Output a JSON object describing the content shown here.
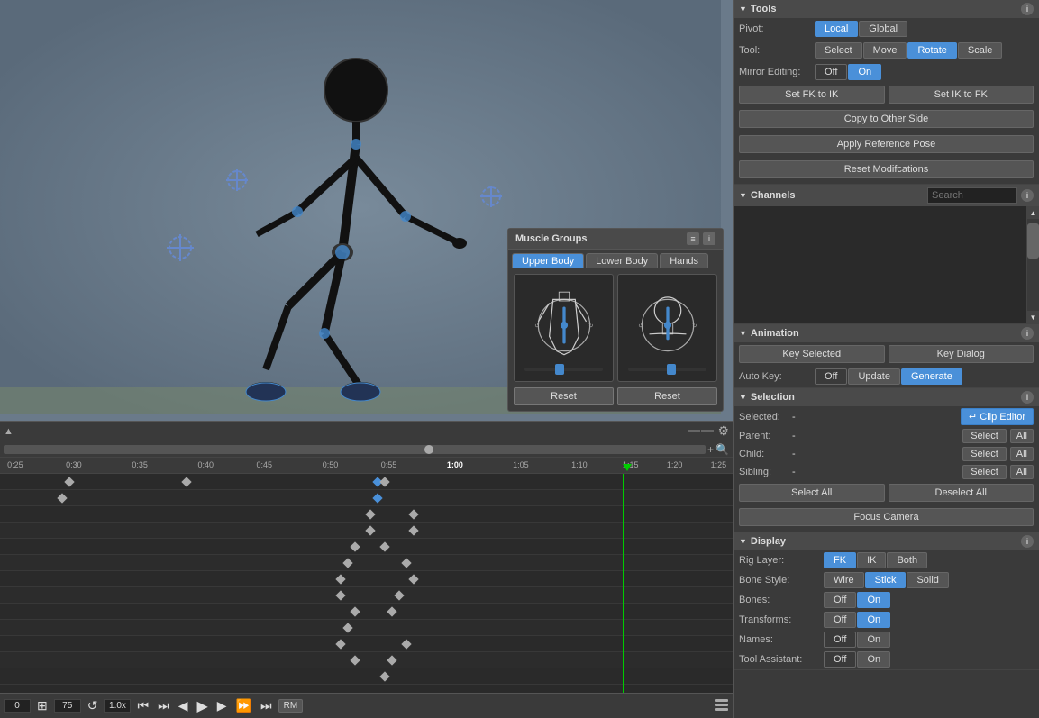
{
  "tools": {
    "title": "Tools",
    "pivot_label": "Pivot:",
    "tool_label": "Tool:",
    "mirror_label": "Mirror Editing:",
    "pivot_buttons": [
      "Local",
      "Global"
    ],
    "tool_buttons": [
      "Select",
      "Move",
      "Rotate",
      "Scale"
    ],
    "mirror_buttons": [
      "Off",
      "On"
    ],
    "active_pivot": "Local",
    "active_tool": "Rotate",
    "active_mirror": "Off",
    "set_fk_ik": "Set FK to IK",
    "set_ik_fk": "Set IK to FK",
    "copy_other_side": "Copy to Other Side",
    "apply_reference_pose": "Apply Reference Pose",
    "reset_modifications": "Reset Modifcations"
  },
  "channels": {
    "title": "Channels",
    "search_placeholder": "Search"
  },
  "animation": {
    "title": "Animation",
    "key_selected": "Key Selected",
    "key_dialog": "Key Dialog",
    "auto_key_label": "Auto Key:",
    "auto_key_buttons": [
      "Off",
      "Update",
      "Generate"
    ],
    "active_auto_key": "Off"
  },
  "selection": {
    "title": "Selection",
    "clip_editor_btn": "↵ Clip Editor",
    "selected_label": "Selected:",
    "selected_value": "-",
    "parent_label": "Parent:",
    "parent_value": "-",
    "child_label": "Child:",
    "child_value": "-",
    "sibling_label": "Sibling:",
    "sibling_value": "-",
    "select_btn": "Select",
    "all_btn": "All",
    "select_all": "Select All",
    "deselect_all": "Deselect All",
    "focus_camera": "Focus Camera"
  },
  "display": {
    "title": "Display",
    "rig_layer_label": "Rig Layer:",
    "rig_layer_buttons": [
      "FK",
      "IK",
      "Both"
    ],
    "active_rig": "FK",
    "bone_style_label": "Bone Style:",
    "bone_style_buttons": [
      "Wire",
      "Stick",
      "Solid"
    ],
    "active_bone": "Stick",
    "bones_label": "Bones:",
    "bones_buttons": [
      "Off",
      "On"
    ],
    "active_bones": "On",
    "transforms_label": "Transforms:",
    "transforms_buttons": [
      "Off",
      "On"
    ],
    "active_transforms": "On",
    "names_label": "Names:",
    "names_buttons": [
      "Off",
      "On"
    ],
    "active_names": "Off",
    "tool_assistant_label": "Tool Assistant:",
    "tool_assistant_buttons": [
      "Off",
      "On"
    ],
    "active_tool_assistant": "Off"
  },
  "muscle_groups": {
    "title": "Muscle Groups",
    "tabs": [
      "Upper Body",
      "Lower Body",
      "Hands"
    ],
    "active_tab": "Upper Body",
    "reset_label": "Reset"
  },
  "timeline": {
    "start_frame": 0,
    "current_frame": 75,
    "speed": "1.0x",
    "mode": "RM",
    "ruler_marks": [
      "0:25",
      "0:30",
      "0:35",
      "0:40",
      "0:45",
      "0:50",
      "0:55",
      "1:00",
      "1:05",
      "1:10",
      "1:15",
      "1:20",
      "1:25"
    ],
    "playhead_position": "1:15"
  },
  "viewport": {
    "select_label": "Select"
  }
}
